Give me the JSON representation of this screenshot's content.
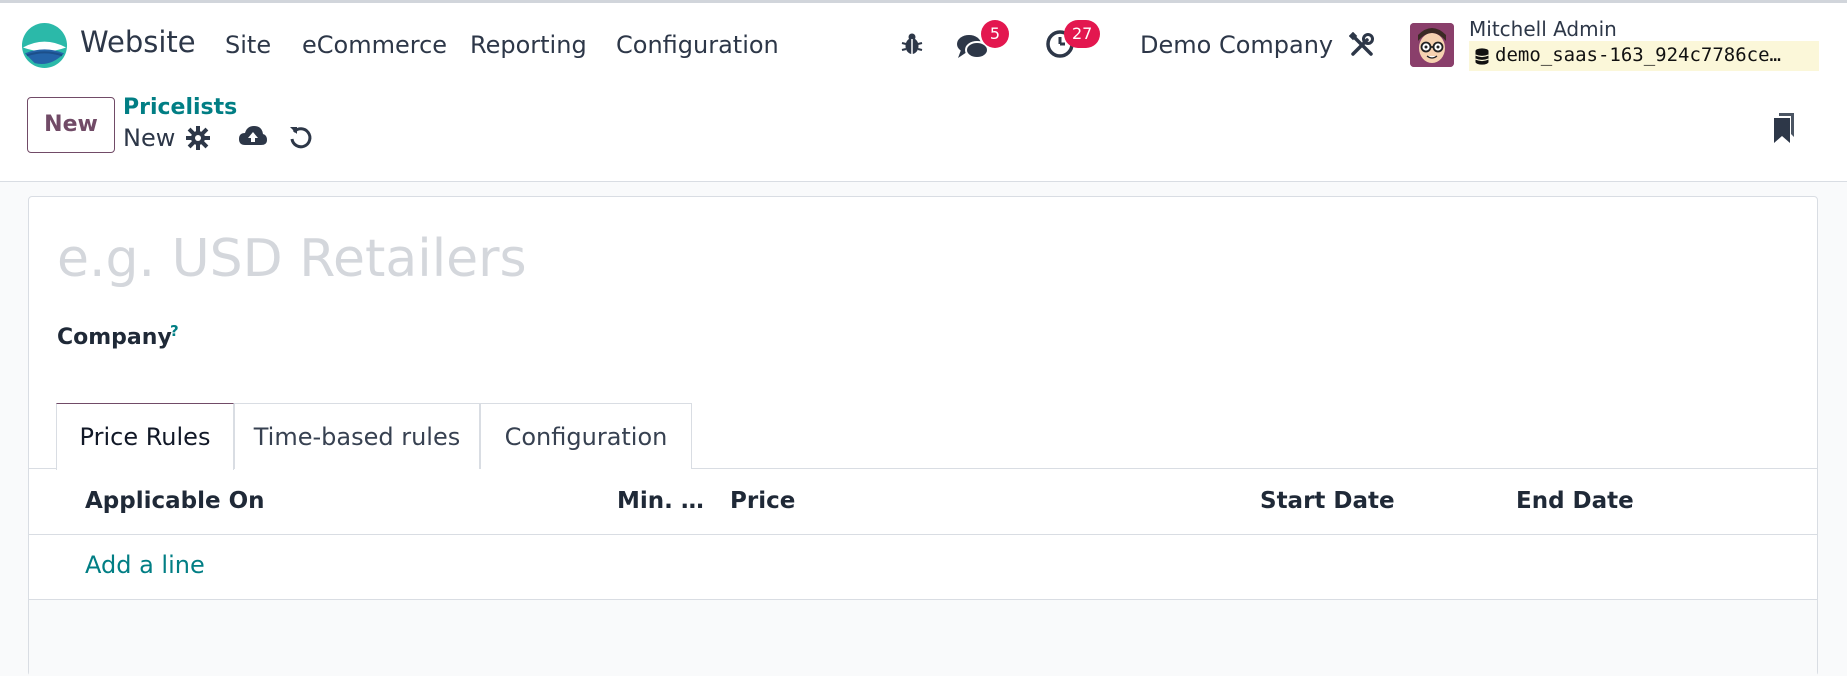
{
  "navbar": {
    "app_name": "Website",
    "menus": [
      "Site",
      "eCommerce",
      "Reporting",
      "Configuration"
    ],
    "messages_count": "5",
    "activities_count": "27",
    "company": "Demo Company",
    "user_name": "Mitchell Admin",
    "database": "demo_saas-163_924c7786ce…"
  },
  "control": {
    "new_label": "New",
    "breadcrumb_parent": "Pricelists",
    "breadcrumb_current": "New"
  },
  "form": {
    "name_placeholder": "e.g. USD Retailers",
    "company_label": "Company",
    "help_mark": "?",
    "tabs": [
      "Price Rules",
      "Time-based rules",
      "Configuration"
    ],
    "columns": [
      "Applicable On",
      "Min. …",
      "Price",
      "Start Date",
      "End Date"
    ],
    "add_line": "Add a line"
  },
  "colors": {
    "brand": "#714b67",
    "link": "#017e84",
    "badge": "#e3174f"
  }
}
